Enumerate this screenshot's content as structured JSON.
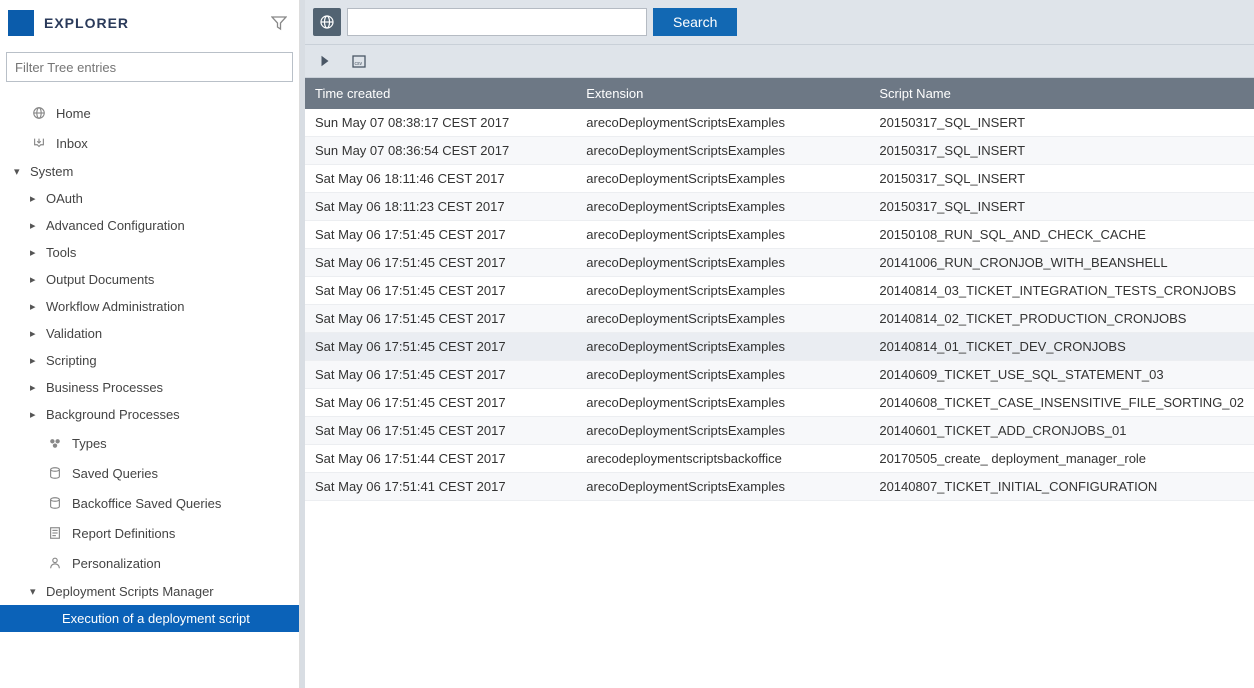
{
  "sidebar": {
    "title": "EXPLORER",
    "filter_placeholder": "Filter Tree entries",
    "items": [
      {
        "label": "Home",
        "icon": "home",
        "caret": "none",
        "level": 0
      },
      {
        "label": "Inbox",
        "icon": "inbox",
        "caret": "none",
        "level": 0
      },
      {
        "label": "System",
        "icon": "",
        "caret": "expanded",
        "level": 0
      },
      {
        "label": "OAuth",
        "icon": "",
        "caret": "collapsed",
        "level": 1
      },
      {
        "label": "Advanced Configuration",
        "icon": "",
        "caret": "collapsed",
        "level": 1
      },
      {
        "label": "Tools",
        "icon": "",
        "caret": "collapsed",
        "level": 1
      },
      {
        "label": "Output Documents",
        "icon": "",
        "caret": "collapsed",
        "level": 1
      },
      {
        "label": "Workflow Administration",
        "icon": "",
        "caret": "collapsed",
        "level": 1
      },
      {
        "label": "Validation",
        "icon": "",
        "caret": "collapsed",
        "level": 1
      },
      {
        "label": "Scripting",
        "icon": "",
        "caret": "collapsed",
        "level": 1
      },
      {
        "label": "Business Processes",
        "icon": "",
        "caret": "collapsed",
        "level": 1
      },
      {
        "label": "Background Processes",
        "icon": "",
        "caret": "collapsed",
        "level": 1
      },
      {
        "label": "Types",
        "icon": "types",
        "caret": "none",
        "level": 1
      },
      {
        "label": "Saved Queries",
        "icon": "query",
        "caret": "none",
        "level": 1
      },
      {
        "label": "Backoffice Saved Queries",
        "icon": "query",
        "caret": "none",
        "level": 1
      },
      {
        "label": "Report Definitions",
        "icon": "report",
        "caret": "none",
        "level": 1
      },
      {
        "label": "Personalization",
        "icon": "person",
        "caret": "none",
        "level": 1
      },
      {
        "label": "Deployment Scripts Manager",
        "icon": "",
        "caret": "expanded",
        "level": 1
      },
      {
        "label": "Execution of a deployment script",
        "icon": "",
        "caret": "none",
        "level": 2,
        "selected": true
      }
    ]
  },
  "search": {
    "button_label": "Search",
    "value": ""
  },
  "table": {
    "columns": [
      "Time created",
      "Extension",
      "Script Name"
    ],
    "rows": [
      {
        "time": "Sun May 07 08:38:17 CEST 2017",
        "ext": "arecoDeploymentScriptsExamples",
        "name": "20150317_SQL_INSERT"
      },
      {
        "time": "Sun May 07 08:36:54 CEST 2017",
        "ext": "arecoDeploymentScriptsExamples",
        "name": "20150317_SQL_INSERT"
      },
      {
        "time": "Sat May 06 18:11:46 CEST 2017",
        "ext": "arecoDeploymentScriptsExamples",
        "name": "20150317_SQL_INSERT"
      },
      {
        "time": "Sat May 06 18:11:23 CEST 2017",
        "ext": "arecoDeploymentScriptsExamples",
        "name": "20150317_SQL_INSERT"
      },
      {
        "time": "Sat May 06 17:51:45 CEST 2017",
        "ext": "arecoDeploymentScriptsExamples",
        "name": "20150108_RUN_SQL_AND_CHECK_CACHE"
      },
      {
        "time": "Sat May 06 17:51:45 CEST 2017",
        "ext": "arecoDeploymentScriptsExamples",
        "name": "20141006_RUN_CRONJOB_WITH_BEANSHELL"
      },
      {
        "time": "Sat May 06 17:51:45 CEST 2017",
        "ext": "arecoDeploymentScriptsExamples",
        "name": "20140814_03_TICKET_INTEGRATION_TESTS_CRONJOBS"
      },
      {
        "time": "Sat May 06 17:51:45 CEST 2017",
        "ext": "arecoDeploymentScriptsExamples",
        "name": "20140814_02_TICKET_PRODUCTION_CRONJOBS"
      },
      {
        "time": "Sat May 06 17:51:45 CEST 2017",
        "ext": "arecoDeploymentScriptsExamples",
        "name": "20140814_01_TICKET_DEV_CRONJOBS",
        "highlight": true
      },
      {
        "time": "Sat May 06 17:51:45 CEST 2017",
        "ext": "arecoDeploymentScriptsExamples",
        "name": "20140609_TICKET_USE_SQL_STATEMENT_03"
      },
      {
        "time": "Sat May 06 17:51:45 CEST 2017",
        "ext": "arecoDeploymentScriptsExamples",
        "name": "20140608_TICKET_CASE_INSENSITIVE_FILE_SORTING_02"
      },
      {
        "time": "Sat May 06 17:51:45 CEST 2017",
        "ext": "arecoDeploymentScriptsExamples",
        "name": "20140601_TICKET_ADD_CRONJOBS_01"
      },
      {
        "time": "Sat May 06 17:51:44 CEST 2017",
        "ext": "arecodeploymentscriptsbackoffice",
        "name": "20170505_create_ deployment_manager_role"
      },
      {
        "time": "Sat May 06 17:51:41 CEST 2017",
        "ext": "arecoDeploymentScriptsExamples",
        "name": "20140807_TICKET_INITIAL_CONFIGURATION"
      }
    ]
  }
}
